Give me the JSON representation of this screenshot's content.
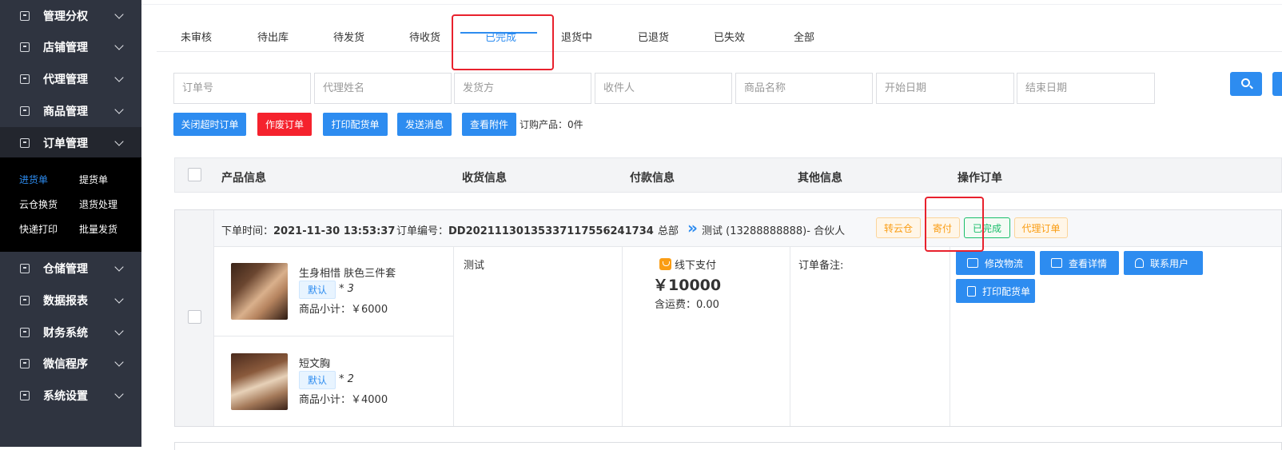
{
  "sidebar": {
    "menu": [
      {
        "label": "管理分权",
        "icon": "shield-icon"
      },
      {
        "label": "店铺管理",
        "icon": "store-icon"
      },
      {
        "label": "代理管理",
        "icon": "agent-icon"
      },
      {
        "label": "商品管理",
        "icon": "goods-icon"
      },
      {
        "label": "订单管理",
        "icon": "order-icon"
      },
      {
        "label": "仓储管理",
        "icon": "warehouse-icon"
      },
      {
        "label": "数据报表",
        "icon": "chart-icon"
      },
      {
        "label": "财务系统",
        "icon": "finance-icon"
      },
      {
        "label": "微信程序",
        "icon": "wechat-icon"
      },
      {
        "label": "系统设置",
        "icon": "settings-icon"
      }
    ],
    "submenu": [
      "进货单",
      "提货单",
      "云仓换货",
      "退货处理",
      "快递打印",
      "批量发货"
    ],
    "active_submenu": "进货单"
  },
  "tabs": [
    "未审核",
    "待出库",
    "待发货",
    "待收货",
    "已完成",
    "退货中",
    "已退货",
    "已失效",
    "全部"
  ],
  "active_tab": "已完成",
  "filters": {
    "order_no": "订单号",
    "agent_name": "代理姓名",
    "sender": "发货方",
    "receiver": "收件人",
    "product_name": "商品名称",
    "start_date": "开始日期",
    "end_date": "结束日期"
  },
  "actions": {
    "close_timeout": "关闭超时订单",
    "void_order": "作废订单",
    "print_picking": "打印配货单",
    "send_message": "发送消息",
    "view_attachment": "查看附件",
    "order_product_count": "订购产品：0件"
  },
  "table_headers": [
    "产品信息",
    "收货信息",
    "付款信息",
    "其他信息",
    "操作订单"
  ],
  "order": {
    "time_label": "下单时间：",
    "time": "2021-11-30 13:53:37",
    "no_label": "订单编号：",
    "no": "DD20211130135337117556241734",
    "hq": "总部",
    "customer": "测试 (13288888888)- 合伙人",
    "tags": [
      "转云仓",
      "寄付",
      "已完成",
      "代理订单"
    ],
    "items": [
      {
        "name": "生身相惜 肤色三件套",
        "spec": "默认",
        "qty": "* 3",
        "subtotal": "商品小计：￥6000"
      },
      {
        "name": "短文胸",
        "spec": "默认",
        "qty": "* 2",
        "subtotal": "商品小计：￥4000"
      }
    ],
    "receiver": "测试",
    "pay_method": "线下支付",
    "amount": "￥10000",
    "freight": "含运费：0.00",
    "remark_label": "订单备注:",
    "buttons": {
      "edit_logistics": "修改物流",
      "view_detail": "查看详情",
      "contact_user": "联系用户",
      "print_picking": "打印配货单"
    }
  },
  "colors": {
    "sidebar_bg": "#2f3440",
    "primary": "#2d8cf0",
    "danger": "#f5222d",
    "tag_orange": "#fa9d14",
    "tag_green": "#19be6b",
    "highlight_box": "#e8212d"
  }
}
